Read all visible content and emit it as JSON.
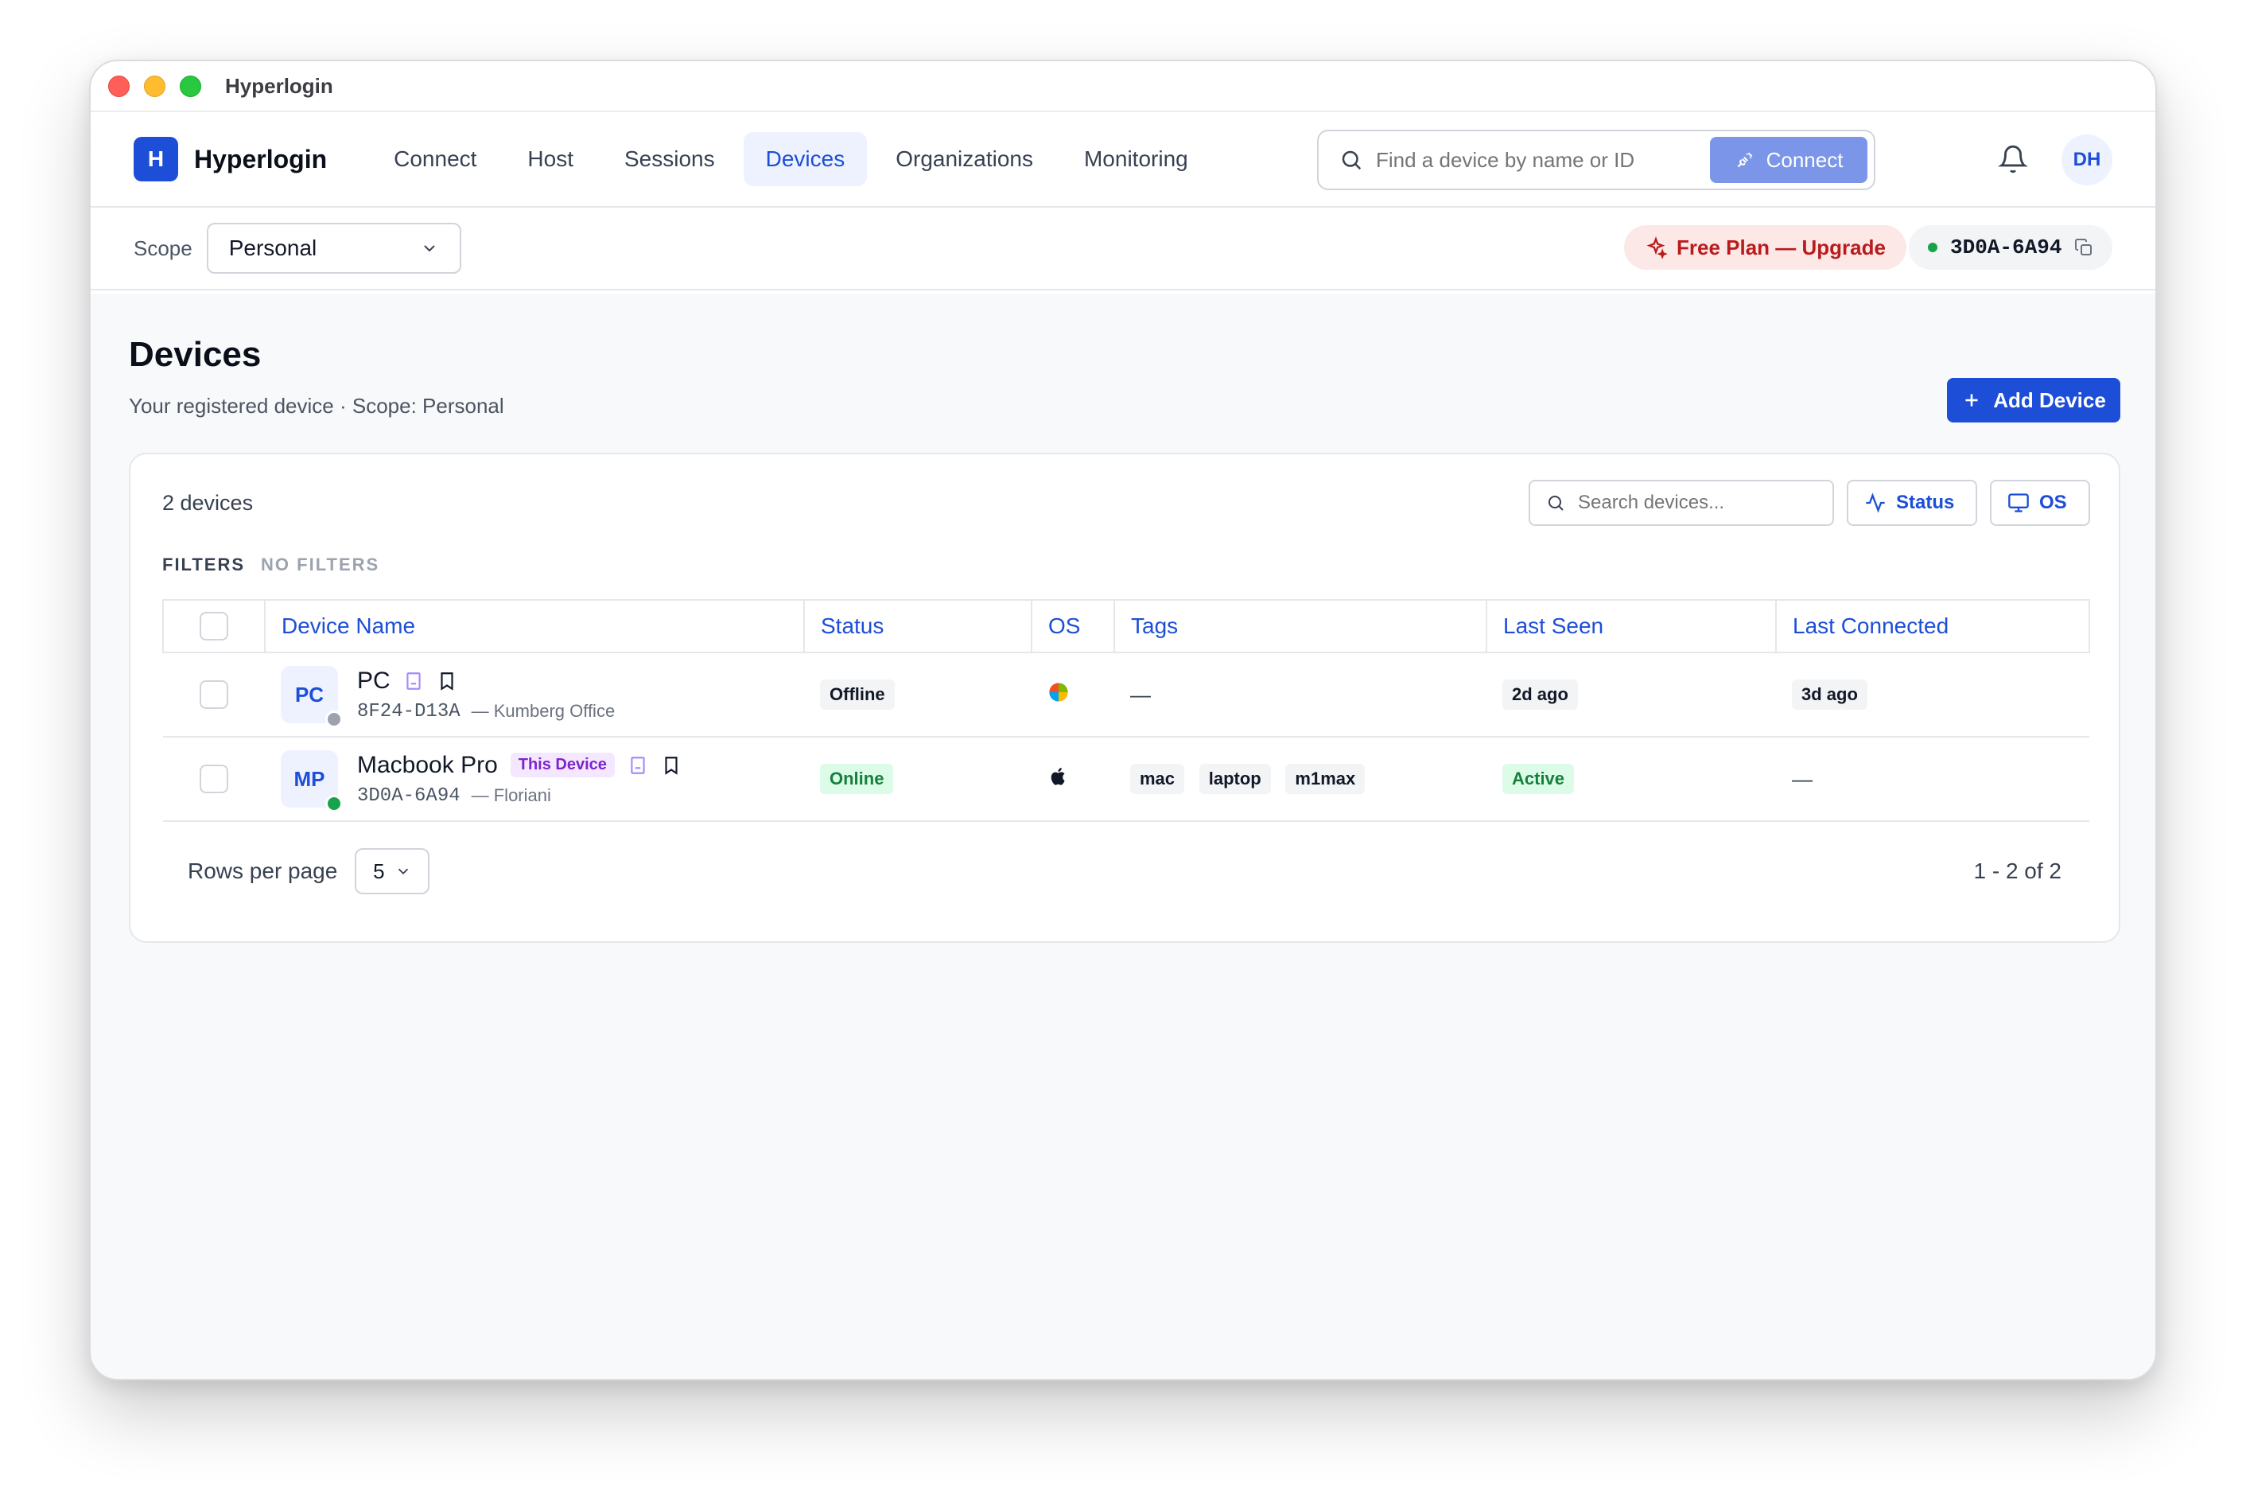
{
  "window": {
    "title": "Hyperlogin"
  },
  "brand": {
    "logo_letter": "H",
    "name": "Hyperlogin",
    "color": "#1d4ed8"
  },
  "nav": {
    "items": [
      {
        "label": "Connect"
      },
      {
        "label": "Host"
      },
      {
        "label": "Sessions"
      },
      {
        "label": "Devices",
        "active": true
      },
      {
        "label": "Organizations"
      },
      {
        "label": "Monitoring"
      }
    ]
  },
  "global_search": {
    "placeholder": "Find a device by name or ID",
    "connect_label": "Connect"
  },
  "user": {
    "initials": "DH"
  },
  "scope": {
    "label": "Scope",
    "value": "Personal"
  },
  "plan": {
    "label": "Free Plan — Upgrade"
  },
  "device_id": {
    "value": "3D0A-6A94"
  },
  "page": {
    "title": "Devices",
    "subtitle": "Your registered device · Scope: Personal",
    "add_label": "Add Device"
  },
  "card": {
    "count": "2 devices",
    "search_placeholder": "Search devices...",
    "status_filter": "Status",
    "os_filter": "OS",
    "filters_label": "FILTERS",
    "filters_value": "NO FILTERS"
  },
  "table": {
    "columns": [
      "Device Name",
      "Status",
      "OS",
      "Tags",
      "Last Seen",
      "Last Connected"
    ],
    "rows": [
      {
        "initials": "PC",
        "name": "PC",
        "this_device": "",
        "id": "8F24-D13A",
        "location": "— Kumberg Office",
        "status": "Offline",
        "os_icon": "windows-icon",
        "tags_empty": "—",
        "last_seen": "2d ago",
        "last_connected": "3d ago"
      },
      {
        "initials": "MP",
        "name": "Macbook Pro",
        "this_device": "This Device",
        "id": "3D0A-6A94",
        "location": "— Floriani",
        "status": "Online",
        "os_icon": "apple-icon",
        "tags": [
          "mac",
          "laptop",
          "m1max"
        ],
        "last_seen": "Active",
        "last_connected_empty": "—"
      }
    ]
  },
  "pagination": {
    "rows_label": "Rows per page",
    "rows_value": "5",
    "range": "1 - 2 of 2"
  },
  "colors": {
    "accent": "#1d4ed8",
    "online": "#16a34a",
    "offline": "#9ca3af",
    "upgrade": "#b91c1c"
  }
}
